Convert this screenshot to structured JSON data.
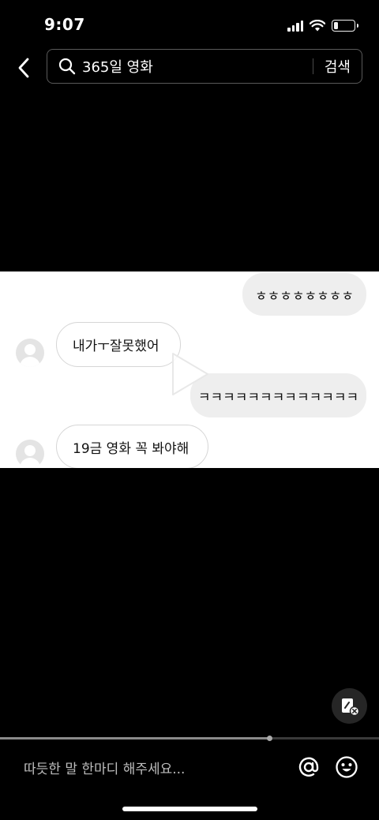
{
  "status_bar": {
    "time": "9:07",
    "battery_level": 0.2
  },
  "header": {
    "search_query": "365일 영화",
    "search_button": "검색"
  },
  "chat": {
    "messages": [
      {
        "side": "right",
        "text": "ㅎㅎㅎㅎㅎㅎㅎㅎ"
      },
      {
        "side": "left",
        "text": "내가ㅜ잘못했어"
      },
      {
        "side": "right",
        "text": "ㅋㅋㅋㅋㅋㅋㅋㅋㅋㅋㅋㅋㅋ"
      },
      {
        "side": "left",
        "text": "19금 영화 꼭 봐야해"
      }
    ]
  },
  "playback": {
    "progress": 0.71
  },
  "comment": {
    "placeholder": "따듯한 말 한마디 해주세요..."
  },
  "icons": {
    "back": "chevron-left-icon",
    "search": "search-icon",
    "shorts": "edit-close-icon",
    "mention": "at-icon",
    "emoji": "smile-icon",
    "play": "play-icon"
  },
  "colors": {
    "background": "#000000",
    "chat_bg": "#ffffff",
    "bubble_right": "#eeeeee"
  }
}
